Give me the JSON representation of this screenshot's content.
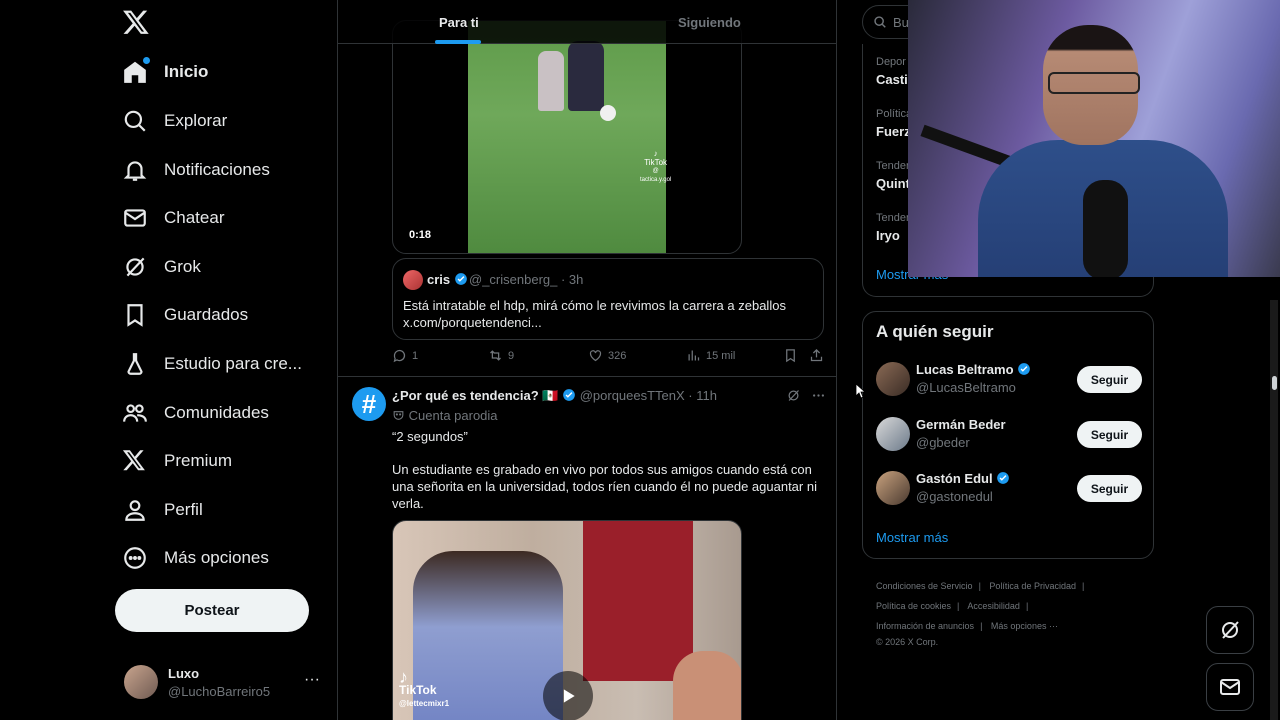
{
  "nav": {
    "logo": "x-logo",
    "items": [
      {
        "label": "Inicio",
        "icon": "home-icon",
        "active": true
      },
      {
        "label": "Explorar",
        "icon": "search-icon"
      },
      {
        "label": "Notificaciones",
        "icon": "bell-icon"
      },
      {
        "label": "Chatear",
        "icon": "mail-icon"
      },
      {
        "label": "Grok",
        "icon": "grok-icon"
      },
      {
        "label": "Guardados",
        "icon": "bookmark-icon"
      },
      {
        "label": "Estudio para cre...",
        "icon": "flask-icon"
      },
      {
        "label": "Comunidades",
        "icon": "people-icon"
      },
      {
        "label": "Premium",
        "icon": "x-icon"
      },
      {
        "label": "Perfil",
        "icon": "person-icon"
      },
      {
        "label": "Más opciones",
        "icon": "more-circle-icon"
      }
    ],
    "post_label": "Postear",
    "account": {
      "name": "Luxo",
      "handle": "@LuchoBarreiro5",
      "more": "···"
    }
  },
  "main": {
    "tabs": [
      {
        "label": "Para ti",
        "active": true
      },
      {
        "label": "Siguiendo"
      }
    ],
    "tweet1": {
      "video_duration": "0:18",
      "tiktok_label": "TikTok",
      "tiktok_handle": "@ tactica.y.gol",
      "quote": {
        "name": "cris",
        "handle": "@_crisenberg_ · 3h",
        "text": "Está intratable el hdp, mirá cómo le revivimos la carrera a zeballos x.com/porquetendenci..."
      },
      "actions": {
        "replies": "1",
        "retweets": "9",
        "likes": "326",
        "views": "15 mil"
      }
    },
    "tweet2": {
      "name": "¿Por qué es tendencia? 🇲🇽",
      "handle": "@porqueesTTenX · 11h",
      "parody": "Cuenta parodia",
      "text1": "“2 segundos”",
      "text2": "Un estudiante es grabado en vivo por todos sus amigos cuando está con una señorita en la universidad, todos ríen cuando él no puede aguantar ni verla.",
      "tiktok_label": "TikTok",
      "tiktok_handle": "@lettecmixr1"
    }
  },
  "right": {
    "search_placeholder": "Bus",
    "trends": [
      {
        "category": "Depor",
        "title": "Casti"
      },
      {
        "category": "Política",
        "title": "Fuerz"
      },
      {
        "category": "Tender",
        "title": "Quint"
      },
      {
        "category": "Tender",
        "title": "Iryo"
      }
    ],
    "trends_more": "Mostrar más",
    "who_title": "A quién seguir",
    "who": [
      {
        "name": "Lucas Beltramo",
        "handle": "@LucasBeltramo",
        "button": "Seguir",
        "verified": true
      },
      {
        "name": "Germán Beder",
        "handle": "@gbeder",
        "button": "Seguir",
        "verified": false
      },
      {
        "name": "Gastón Edul",
        "handle": "@gastonedul",
        "button": "Seguir",
        "verified": true
      }
    ],
    "who_more": "Mostrar más",
    "footer": {
      "links": [
        "Condiciones de Servicio",
        "Política de Privacidad",
        "Política de cookies",
        "Accesibilidad",
        "Información de anuncios",
        "Más opciones ···"
      ],
      "copyright": "© 2026 X Corp."
    }
  },
  "colors": {
    "accent": "#1d9bf0",
    "background": "#000000",
    "border": "#2f3336",
    "muted": "#71767b"
  }
}
